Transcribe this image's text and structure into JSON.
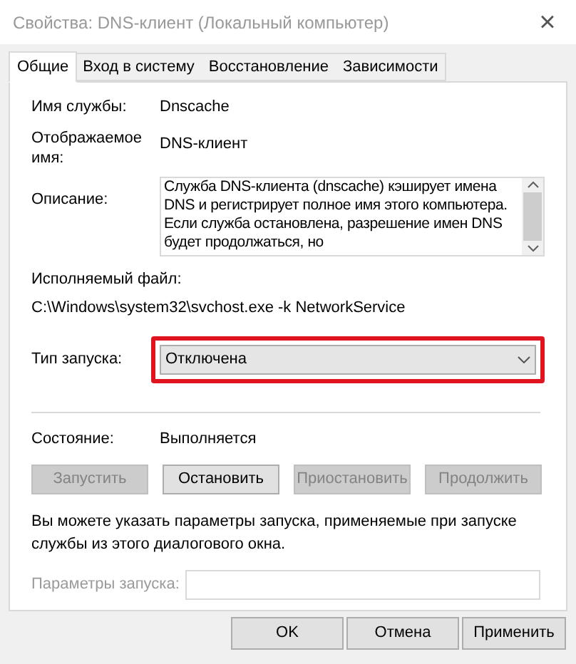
{
  "window": {
    "title": "Свойства: DNS-клиент (Локальный компьютер)",
    "close": "×"
  },
  "tabs": [
    {
      "label": "Общие",
      "selected": true
    },
    {
      "label": "Вход в систему",
      "selected": false
    },
    {
      "label": "Восстановление",
      "selected": false
    },
    {
      "label": "Зависимости",
      "selected": false
    }
  ],
  "service_name": {
    "label": "Имя службы:",
    "value": "Dnscache"
  },
  "display_name": {
    "label": "Отображаемое имя:",
    "value": "DNS-клиент"
  },
  "description": {
    "label": "Описание:",
    "value": "Служба DNS-клиента (dnscache) кэширует имена DNS и регистрирует полное имя этого компьютера. Если служба остановлена, разрешение имен DNS будет продолжаться, но"
  },
  "executable": {
    "label": "Исполняемый файл:",
    "value": "C:\\Windows\\system32\\svchost.exe -k NetworkService"
  },
  "startup_type": {
    "label": "Тип запуска:",
    "value": "Отключена",
    "highlighted": true
  },
  "status": {
    "label": "Состояние:",
    "value": "Выполняется"
  },
  "service_buttons": [
    {
      "label": "Запустить",
      "disabled": true
    },
    {
      "label": "Остановить",
      "disabled": false
    },
    {
      "label": "Приостановить",
      "disabled": true
    },
    {
      "label": "Продолжить",
      "disabled": true
    }
  ],
  "hint": "Вы можете указать параметры запуска, применяемые при запуске службы из этого диалогового окна.",
  "start_params": {
    "label": "Параметры запуска:",
    "disabled": true
  },
  "dialog_buttons": [
    "OK",
    "Отмена",
    "Применить"
  ]
}
